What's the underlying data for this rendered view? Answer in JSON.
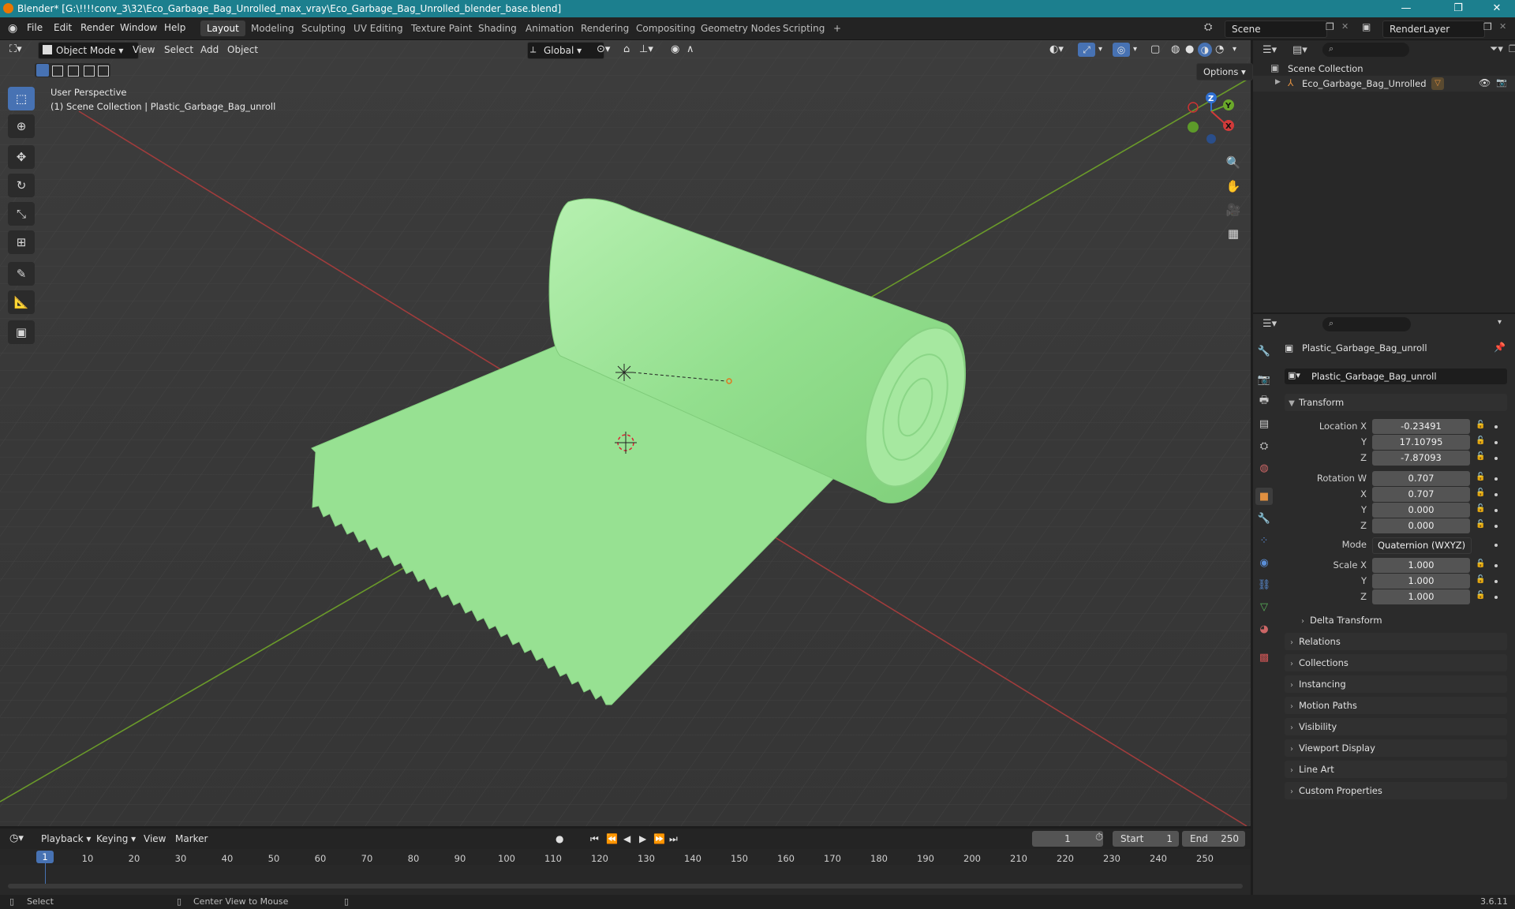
{
  "window": {
    "title": "Blender* [G:\\!!!!conv_3\\32\\Eco_Garbage_Bag_Unrolled_max_vray\\Eco_Garbage_Bag_Unrolled_blender_base.blend]",
    "minimize": "—",
    "maximize": "❐",
    "close": "✕"
  },
  "menu": [
    "File",
    "Edit",
    "Render",
    "Window",
    "Help"
  ],
  "workspaces": [
    "Layout",
    "Modeling",
    "Sculpting",
    "UV Editing",
    "Texture Paint",
    "Shading",
    "Animation",
    "Rendering",
    "Compositing",
    "Geometry Nodes",
    "Scripting"
  ],
  "workspace_add": "+",
  "scene": {
    "name": "Scene",
    "render_layer": "RenderLayer"
  },
  "viewport": {
    "mode": "Object Mode",
    "menus": [
      "View",
      "Select",
      "Add",
      "Object"
    ],
    "transform_orientation": "Global",
    "options": "Options",
    "overlay_line1": "User Perspective",
    "overlay_line2": "(1) Scene Collection | Plastic_Garbage_Bag_unroll",
    "gizmo": {
      "x": "X",
      "y": "Y",
      "z": "Z"
    }
  },
  "outliner": {
    "root": "Scene Collection",
    "items": [
      {
        "name": "Eco_Garbage_Bag_Unrolled"
      }
    ]
  },
  "properties": {
    "object_name": "Plastic_Garbage_Bag_unroll",
    "datablock": "Plastic_Garbage_Bag_unroll",
    "transform_title": "Transform",
    "location": {
      "label": "Location X",
      "x": "-0.23491",
      "y": "17.10795",
      "z": "-7.87093"
    },
    "rotation": {
      "label": "Rotation W",
      "w": "0.707",
      "x": "0.707",
      "y": "0.000",
      "z": "0.000"
    },
    "mode_label": "Mode",
    "mode_value": "Quaternion (WXYZ)",
    "scale": {
      "label": "Scale X",
      "x": "1.000",
      "y": "1.000",
      "z": "1.000"
    },
    "axis_labels": {
      "x": "X",
      "y": "Y",
      "z": "Z"
    },
    "delta": "Delta Transform",
    "sections": [
      "Relations",
      "Collections",
      "Instancing",
      "Motion Paths",
      "Visibility",
      "Viewport Display",
      "Line Art",
      "Custom Properties"
    ]
  },
  "timeline": {
    "menus": [
      "Playback",
      "Keying",
      "View",
      "Marker"
    ],
    "current_frame": "1",
    "start_label": "Start",
    "start": "1",
    "end_label": "End",
    "end": "250",
    "playhead": "1",
    "ticks": [
      "10",
      "20",
      "30",
      "40",
      "50",
      "60",
      "70",
      "80",
      "90",
      "100",
      "110",
      "120",
      "130",
      "140",
      "150",
      "160",
      "170",
      "180",
      "190",
      "200",
      "210",
      "220",
      "230",
      "240",
      "250"
    ]
  },
  "status": {
    "select": "Select",
    "center": "Center View to Mouse",
    "version": "3.6.11"
  },
  "colors": {
    "accent": "#4772b3",
    "titlebar": "#1c7f8e",
    "mesh": "#9be59b",
    "x_axis": "#a03c3c",
    "y_axis": "#6a9a2a"
  }
}
